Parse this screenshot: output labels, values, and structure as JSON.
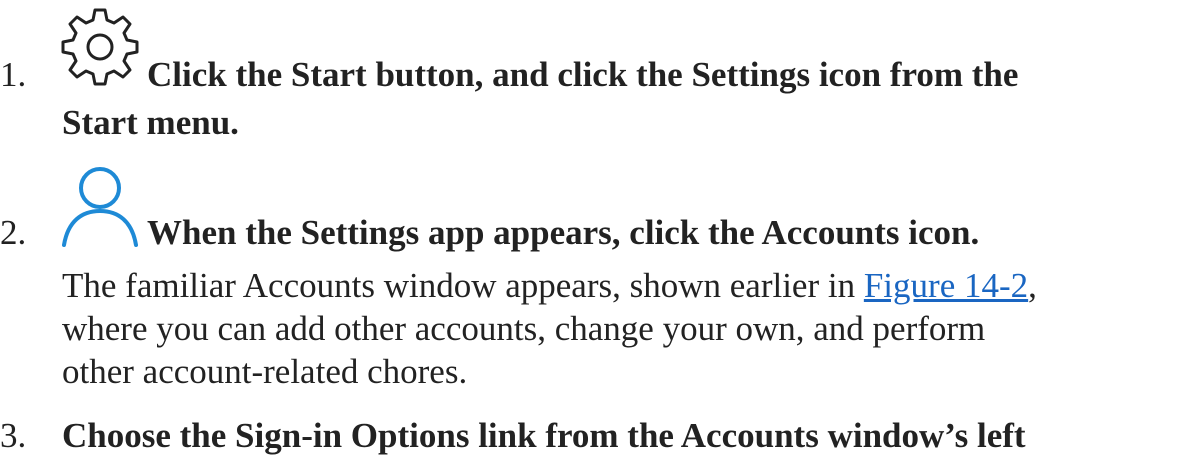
{
  "steps": [
    {
      "number": "1.",
      "icon": "gear-icon",
      "instruction_line1": "Click the Start button, and click the Settings icon from the",
      "instruction_line2": "Start menu."
    },
    {
      "number": "2.",
      "icon": "person-icon",
      "instruction_line1": "When the Settings app appears, click the Accounts icon.",
      "description_line1_before": "The familiar Accounts window appears, shown earlier in ",
      "description_link": "Figure 14-2",
      "description_line1_after": ",",
      "description_line2": "where you can add other accounts, change your own, and perform",
      "description_line3": "other account-related chores."
    },
    {
      "number": "3.",
      "instruction_line1": "Choose the Sign-in Options link from the Accounts window’s left"
    }
  ],
  "colors": {
    "text": "#222222",
    "link": "#1a66c2",
    "person_icon": "#1e8ad6"
  }
}
